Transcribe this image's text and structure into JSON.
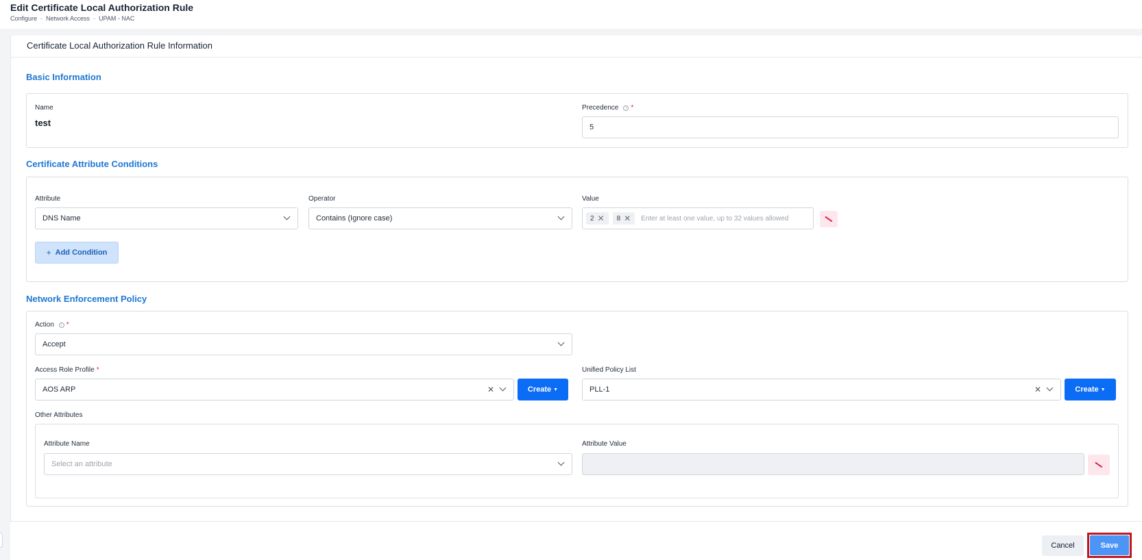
{
  "page": {
    "title": "Edit Certificate Local Authorization Rule",
    "breadcrumb": [
      "Configure",
      "Network Access",
      "UPAM - NAC"
    ],
    "breadcrumb_sep": "-"
  },
  "card": {
    "title": "Certificate Local Authorization Rule Information"
  },
  "basic": {
    "section_title": "Basic Information",
    "name_label": "Name",
    "name_value": "test",
    "precedence_label": "Precedence",
    "precedence_value": "5"
  },
  "conditions": {
    "section_title": "Certificate Attribute Conditions",
    "attribute_label": "Attribute",
    "operator_label": "Operator",
    "value_label": "Value",
    "attribute_value": "DNS Name",
    "operator_value": "Contains (Ignore case)",
    "tags": [
      "2",
      "8"
    ],
    "value_placeholder": "Enter at least one value, up to 32 values allowed",
    "add_condition_label": "Add Condition"
  },
  "enforcement": {
    "section_title": "Network Enforcement Policy",
    "action_label": "Action",
    "action_value": "Accept",
    "arp_label": "Access Role Profile",
    "arp_value": "AOS ARP",
    "create_label": "Create",
    "upl_label": "Unified Policy List",
    "upl_value": "PLL-1",
    "other_label": "Other Attributes",
    "attr_name_label": "Attribute Name",
    "attr_name_placeholder": "Select an attribute",
    "attr_value_label": "Attribute Value"
  },
  "footer": {
    "cancel_label": "Cancel",
    "save_label": "Save"
  },
  "colors": {
    "accent": "#1d77d4",
    "primary_button": "#0b6cf5",
    "danger": "#e11d48",
    "highlight": "#c0151c"
  }
}
